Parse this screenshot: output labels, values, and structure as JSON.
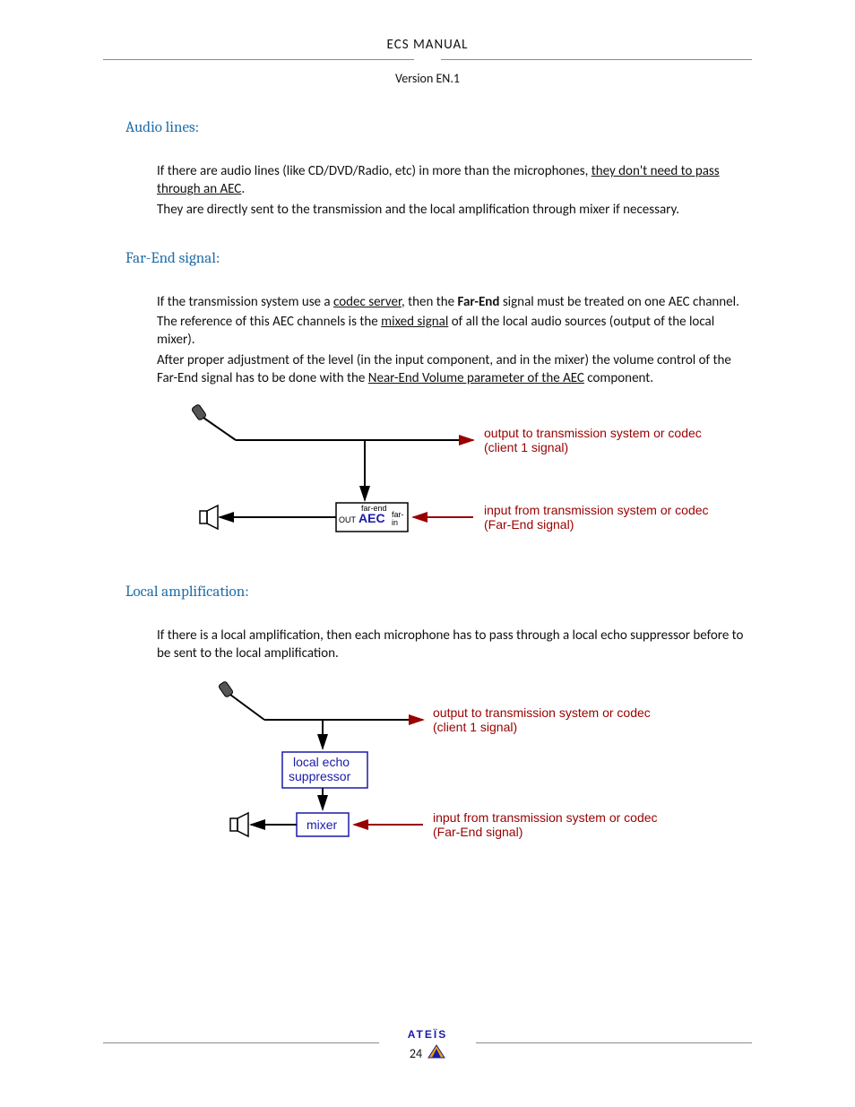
{
  "header": {
    "title": "ECS  MANUAL",
    "version": "Version EN.1"
  },
  "sections": {
    "audio": {
      "heading": "Audio lines:",
      "p1a": "If there are audio lines (like CD/DVD/Radio, etc) in more than the microphones, ",
      "p1u": "they don't need to pass through an AEC",
      "p1b": ".",
      "p2": "They are directly sent to the transmission and the local amplification through mixer if necessary."
    },
    "farend": {
      "heading": "Far-End signal:",
      "p1a": "If the transmission system use a ",
      "p1u": "codec server",
      "p1b": ", then the ",
      "p1bold": "Far-End",
      "p1c": " signal must be treated on one AEC  channel.",
      "p2a": "The reference of this AEC channels is the ",
      "p2u": "mixed signal",
      "p2b": " of all the local audio sources (output of the local mixer).",
      "p3a": "After proper adjustment of the level (in the input component, and in the mixer) the volume control of the Far-End signal has to be done with the ",
      "p3u": "Near-End Volume parameter of the AEC",
      "p3b": " component."
    },
    "local": {
      "heading": "Local amplification:",
      "p1": "If there is a local amplification, then each microphone has to pass through a local echo suppressor before to be sent to the local amplification."
    }
  },
  "diagram1": {
    "out_label_l1": "output to transmission system or codec",
    "out_label_l2": "(client 1 signal)",
    "in_label_l1": "input from transmission system or codec",
    "in_label_l2": "(Far-End signal)",
    "aec": "AEC",
    "aec_out": "OUT",
    "aec_farend": "far-end",
    "aec_farin_l1": "far-",
    "aec_farin_l2": "in"
  },
  "diagram2": {
    "out_label_l1": "output to transmission system or codec",
    "out_label_l2": "(client 1 signal)",
    "in_label_l1": "input from transmission system or codec",
    "in_label_l2": "(Far-End signal)",
    "box1_l1": "local echo",
    "box1_l2": "suppressor",
    "box2": "mixer"
  },
  "footer": {
    "brand": "ATEÏS",
    "page": "24"
  }
}
